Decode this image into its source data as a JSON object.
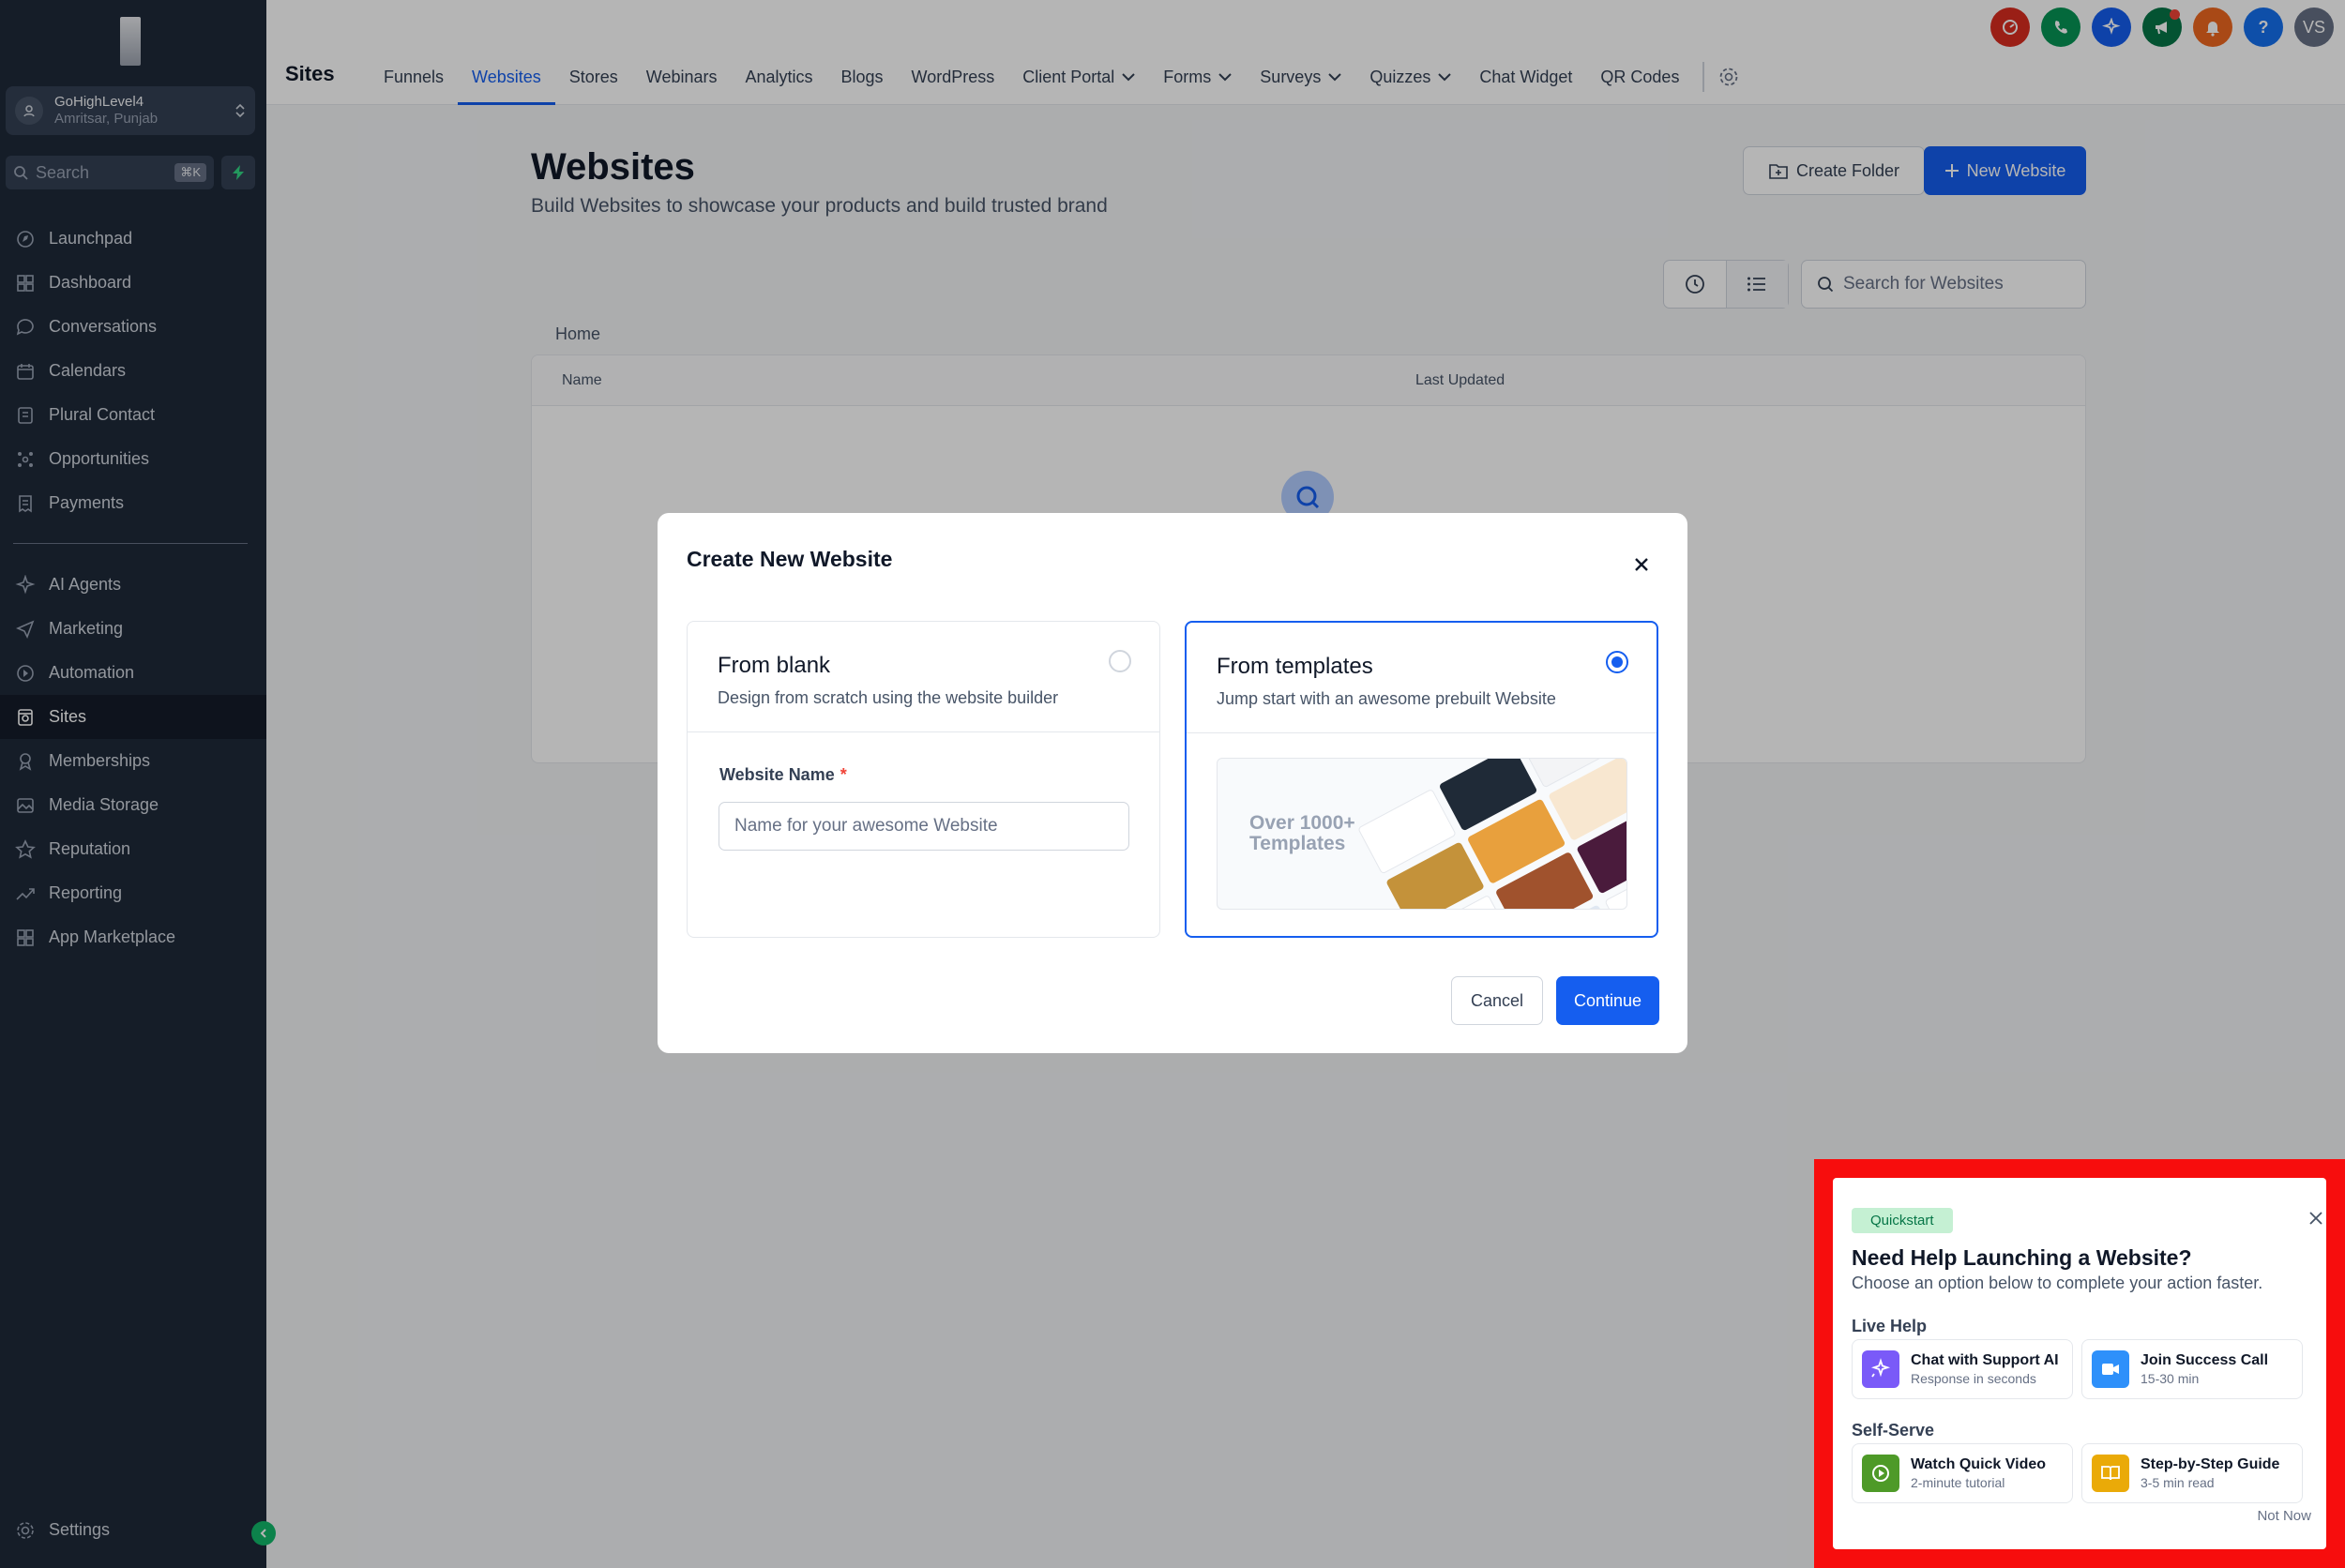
{
  "sidebar": {
    "account": {
      "name": "GoHighLevel4",
      "location": "Amritsar, Punjab"
    },
    "search": {
      "placeholder": "Search",
      "shortcut": "⌘K"
    },
    "items_top": [
      {
        "label": "Launchpad",
        "icon": "launchpad-icon"
      },
      {
        "label": "Dashboard",
        "icon": "dashboard-grid-icon"
      },
      {
        "label": "Conversations",
        "icon": "chat-bubble-icon"
      },
      {
        "label": "Calendars",
        "icon": "calendar-icon"
      },
      {
        "label": "Plural Contact",
        "icon": "contact-book-icon"
      },
      {
        "label": "Opportunities",
        "icon": "network-icon"
      },
      {
        "label": "Payments",
        "icon": "receipt-icon"
      }
    ],
    "items_bottom": [
      {
        "label": "AI Agents",
        "icon": "sparkle-icon"
      },
      {
        "label": "Marketing",
        "icon": "paper-plane-icon"
      },
      {
        "label": "Automation",
        "icon": "automation-icon"
      },
      {
        "label": "Sites",
        "icon": "globe-icon",
        "active": true
      },
      {
        "label": "Memberships",
        "icon": "award-icon"
      },
      {
        "label": "Media Storage",
        "icon": "image-icon"
      },
      {
        "label": "Reputation",
        "icon": "star-icon"
      },
      {
        "label": "Reporting",
        "icon": "trend-icon"
      },
      {
        "label": "App Marketplace",
        "icon": "apps-grid-icon"
      }
    ],
    "settings_label": "Settings"
  },
  "topnav": {
    "title": "Sites",
    "tabs": [
      {
        "label": "Funnels"
      },
      {
        "label": "Websites",
        "active": true
      },
      {
        "label": "Stores"
      },
      {
        "label": "Webinars"
      },
      {
        "label": "Analytics"
      },
      {
        "label": "Blogs"
      },
      {
        "label": "WordPress"
      },
      {
        "label": "Client Portal",
        "dropdown": true
      },
      {
        "label": "Forms",
        "dropdown": true
      },
      {
        "label": "Surveys",
        "dropdown": true
      },
      {
        "label": "Quizzes",
        "dropdown": true
      },
      {
        "label": "Chat Widget"
      },
      {
        "label": "QR Codes"
      }
    ],
    "header_icons": [
      {
        "name": "speedometer-icon",
        "color": "#d92d20"
      },
      {
        "name": "phone-icon",
        "color": "#079455"
      },
      {
        "name": "ai-sparkle-icon",
        "color": "#155eef"
      },
      {
        "name": "megaphone-icon",
        "color": "#067647"
      },
      {
        "name": "bell-icon",
        "color": "#ef6820"
      },
      {
        "name": "help-icon",
        "color": "#1570ef"
      },
      {
        "name": "user-avatar",
        "color": "#667085",
        "initials": "VS"
      }
    ]
  },
  "main": {
    "title": "Websites",
    "subtitle": "Build Websites to showcase your products and build trusted brand",
    "create_folder_label": "Create Folder",
    "new_website_label": "New Website",
    "search_placeholder": "Search for Websites",
    "breadcrumb": "Home",
    "columns": [
      "Name",
      "Last Updated"
    ]
  },
  "modal": {
    "title": "Create New Website",
    "blank": {
      "title": "From blank",
      "description": "Design from scratch using the website builder",
      "field_label": "Website Name",
      "required_mark": "*",
      "placeholder": "Name for your awesome Website"
    },
    "templates": {
      "title": "From templates",
      "description": "Jump start with an awesome prebuilt Website",
      "preview_line1": "Over 1000+",
      "preview_line2": "Templates",
      "selected": true
    },
    "cancel_label": "Cancel",
    "continue_label": "Continue"
  },
  "quickstart": {
    "badge": "Quickstart",
    "title": "Need Help Launching a Website?",
    "subtitle": "Choose an option below to complete your action faster.",
    "live_help_label": "Live Help",
    "self_serve_label": "Self-Serve",
    "cards": [
      {
        "title": "Chat with Support AI",
        "sub": "Response in seconds",
        "icon": "ai-sparkle-icon",
        "color": "#7a5af8"
      },
      {
        "title": "Join Success Call",
        "sub": "15-30 min",
        "icon": "video-camera-icon",
        "color": "#2e90fa"
      },
      {
        "title": "Watch Quick Video",
        "sub": "2-minute tutorial",
        "icon": "play-circle-icon",
        "color": "#4e9a28"
      },
      {
        "title": "Step-by-Step Guide",
        "sub": "3-5 min read",
        "icon": "book-icon",
        "color": "#eaaa08"
      }
    ],
    "not_now_label": "Not Now"
  }
}
